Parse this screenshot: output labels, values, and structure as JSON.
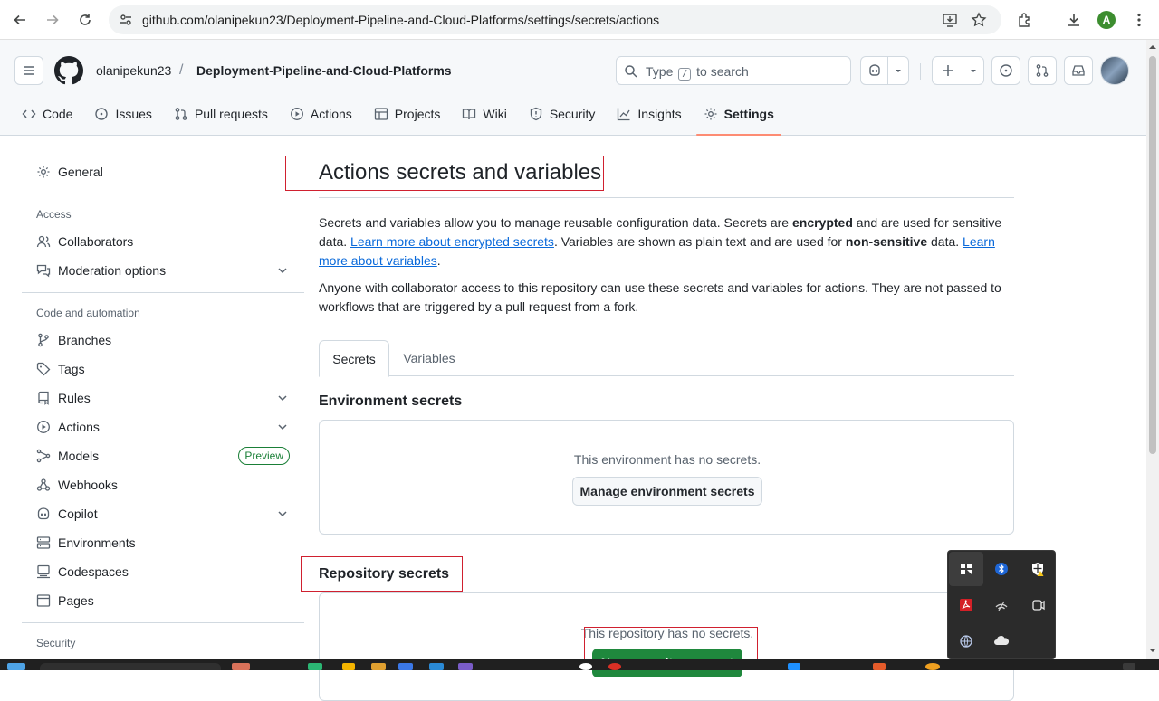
{
  "browser": {
    "url": "github.com/olanipekun23/Deployment-Pipeline-and-Cloud-Platforms/settings/secrets/actions",
    "profile_initial": "A"
  },
  "header": {
    "owner": "olanipekun23",
    "separator": "/",
    "repo": "Deployment-Pipeline-and-Cloud-Platforms",
    "search_prefix": "Type",
    "search_key": "/",
    "search_suffix": "to search"
  },
  "repo_tabs": [
    {
      "label": "Code",
      "icon": "code-icon"
    },
    {
      "label": "Issues",
      "icon": "issue-icon"
    },
    {
      "label": "Pull requests",
      "icon": "pull-request-icon"
    },
    {
      "label": "Actions",
      "icon": "play-icon"
    },
    {
      "label": "Projects",
      "icon": "table-icon"
    },
    {
      "label": "Wiki",
      "icon": "book-icon"
    },
    {
      "label": "Security",
      "icon": "shield-icon"
    },
    {
      "label": "Insights",
      "icon": "graph-icon"
    },
    {
      "label": "Settings",
      "icon": "gear-icon"
    }
  ],
  "sidebar": {
    "general": "General",
    "access_heading": "Access",
    "collaborators": "Collaborators",
    "moderation": "Moderation options",
    "code_heading": "Code and automation",
    "branches": "Branches",
    "tags": "Tags",
    "rules": "Rules",
    "actions": "Actions",
    "models": "Models",
    "preview_badge": "Preview",
    "webhooks": "Webhooks",
    "copilot": "Copilot",
    "environments": "Environments",
    "codespaces": "Codespaces",
    "pages": "Pages",
    "security_heading": "Security"
  },
  "main": {
    "title": "Actions secrets and variables",
    "desc_part1": "Secrets and variables allow you to manage reusable configuration data. Secrets are ",
    "desc_bold1": "encrypted",
    "desc_part2": " and are used for sensitive data. ",
    "desc_link1": "Learn more about encrypted secrets",
    "desc_part3": ". Variables are shown as plain text and are used for ",
    "desc_bold2": "non-sensitive",
    "desc_part4": " data. ",
    "desc_link2": "Learn more about variables",
    "desc_part5": ".",
    "desc2": "Anyone with collaborator access to this repository can use these secrets and variables for actions. They are not passed to workflows that are triggered by a pull request from a fork.",
    "tab_secrets": "Secrets",
    "tab_variables": "Variables",
    "env_title": "Environment secrets",
    "env_empty": "This environment has no secrets.",
    "env_button": "Manage environment secrets",
    "repo_title": "Repository secrets",
    "repo_empty": "This repository has no secrets.",
    "repo_button": "New repository secret"
  },
  "colors": {
    "accent": "#0969da",
    "tab_underline": "#fd8c73",
    "primary_button": "#1f883d",
    "annotation": "#d0202f"
  }
}
